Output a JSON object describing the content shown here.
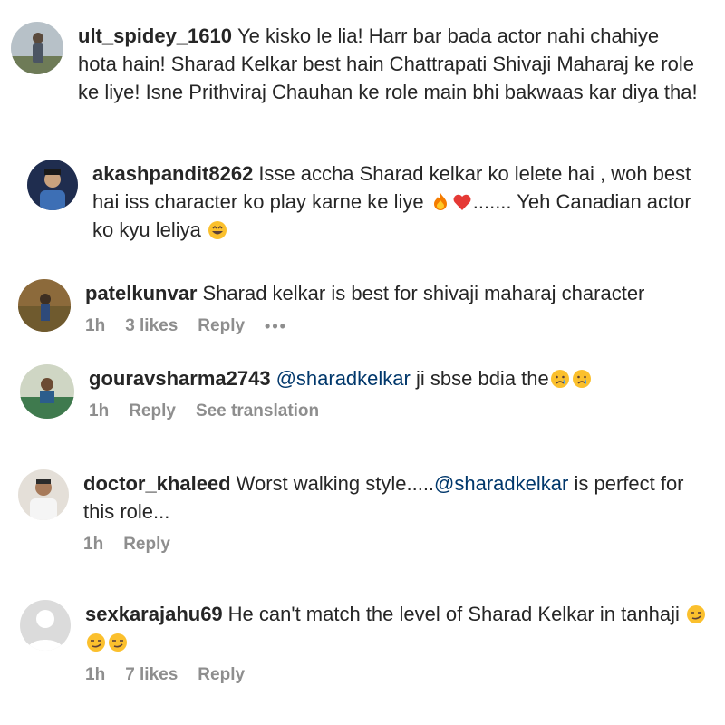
{
  "comments": [
    {
      "user": "ult_spidey_1610",
      "text": "Ye kisko le lia! Harr bar bada actor nahi chahiye hota hain! Sharad Kelkar best hain Chattrapati Shivaji Maharaj ke role ke liye! Isne Prithviraj Chauhan ke role main bhi bakwaas kar diya tha!",
      "avatar_color": "#9aa6b2"
    },
    {
      "user": "akashpandit8262",
      "text_before": "Isse accha Sharad kelkar ko lelete hai , woh best hai iss character ko play karne ke liye",
      "text_after": "....... Yeh Canadian actor ko kyu leliya",
      "emojis_mid": [
        "fire-emoji",
        "red-heart-emoji"
      ],
      "emojis_end": [
        "laughing-emoji"
      ],
      "avatar_color": "#2f3f6b"
    },
    {
      "user": "patelkunvar",
      "text": "Sharad kelkar is best for shivaji maharaj character",
      "time": "1h",
      "likes": "3 likes",
      "reply": "Reply",
      "more": "•••",
      "avatar_color": "#a0763c"
    },
    {
      "user": "gouravsharma2743",
      "mention": "@sharadkelkar",
      "text": "ji sbse bdia the",
      "emojis_end": [
        "crying-emoji",
        "crying-emoji"
      ],
      "time": "1h",
      "reply": "Reply",
      "translation": "See translation",
      "avatar_color": "#7a8c6a"
    },
    {
      "user": "doctor_khaleed",
      "text_before": "Worst walking style.....",
      "mention": "@sharadkelkar",
      "text_after": "is perfect for this role...",
      "time": "1h",
      "reply": "Reply",
      "avatar_color": "#c9c2bb"
    },
    {
      "user": "sexkarajahu69",
      "text": "He can't match the level of Sharad Kelkar in tanhaji",
      "emojis_end": [
        "smirk-emoji",
        "smirk-emoji",
        "smirk-emoji"
      ],
      "time": "1h",
      "likes": "7 likes",
      "reply": "Reply",
      "avatar_color": "#dbdbdb"
    }
  ]
}
